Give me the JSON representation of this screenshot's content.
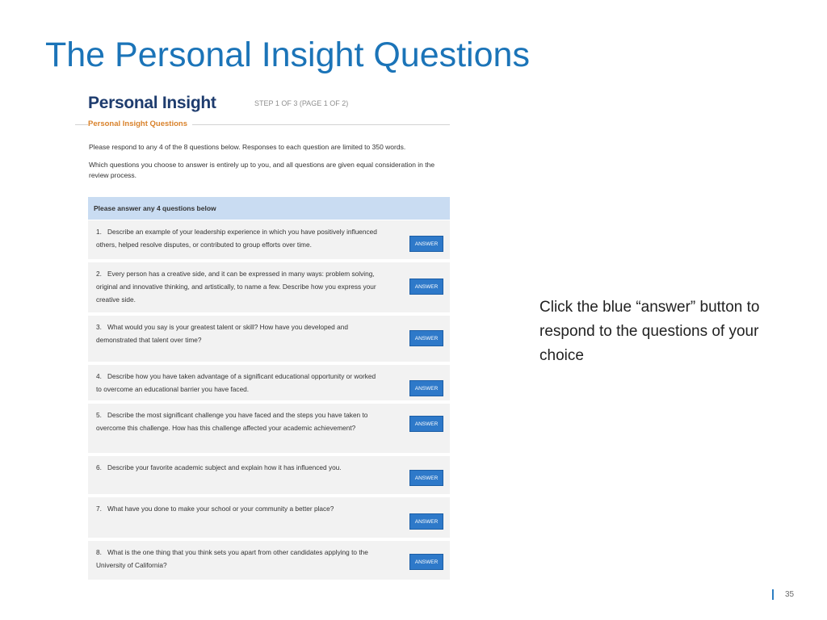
{
  "slide": {
    "title": "The Personal Insight Questions",
    "callout": "Click the blue “answer” button to respond to the questions of your choice",
    "page_number": "35"
  },
  "panel": {
    "title": "Personal Insight",
    "step": "STEP 1 OF 3 (PAGE 1 OF 2)",
    "section_label": "Personal Insight Questions",
    "intro1": "Please respond to any 4 of the 8 questions below. Responses to each question are limited to 350 words.",
    "intro2": "Which questions you choose to answer is entirely up to you, and all questions are given equal consideration in the review process.",
    "questions_header": "Please answer any 4 questions below",
    "answer_label": "ANSWER",
    "questions": [
      {
        "num": "1.",
        "text": "Describe an example of your leadership experience in which you have positively influenced others, helped resolve disputes, or contributed to group efforts over time."
      },
      {
        "num": "2.",
        "text": "Every person has a creative side, and it can be expressed in many ways: problem solving, original and innovative thinking, and artistically, to name a few. Describe how you express your creative side."
      },
      {
        "num": "3.",
        "text": "What would you say is your greatest talent or skill? How have you developed and demonstrated that talent over time?"
      },
      {
        "num": "4.",
        "text": "Describe how you have taken advantage of a significant educational opportunity or worked to overcome an educational barrier you have faced."
      },
      {
        "num": "5.",
        "text": "Describe the most significant challenge you have faced and the steps you have taken to overcome this challenge. How has this challenge affected your academic achievement?"
      },
      {
        "num": "6.",
        "text": "Describe your favorite academic subject and explain how it has influenced you."
      },
      {
        "num": "7.",
        "text": "What have you done to make your school or your community a better place?"
      },
      {
        "num": "8.",
        "text": "What is the one thing that you think sets you apart from other candidates applying to the University of California?"
      }
    ]
  }
}
